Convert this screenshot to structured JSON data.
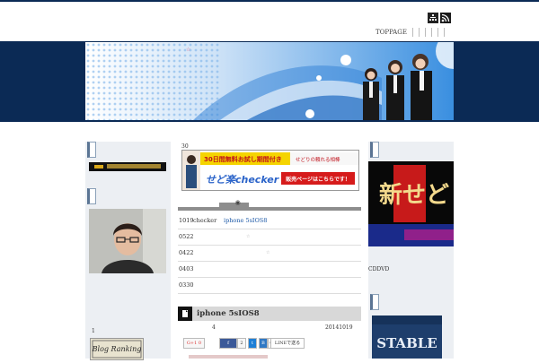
{
  "header": {
    "icons": [
      "sitemap-icon",
      "rss-icon"
    ],
    "nav": {
      "toppage": "TOPPAGE"
    },
    "banner_mark": "☆"
  },
  "left_sidebar": {
    "note": "1",
    "ranking_logo_text": "Blog Ranking"
  },
  "main": {
    "ad_count": "30",
    "ad_top_text": "30日間無料お試し期間付き",
    "ad_top_right": "せどりの頼れる相棒",
    "ad_logo": "せど楽checker",
    "ad_button": "販売ページはこちらです！",
    "list": [
      {
        "date": "1019",
        "extra": "checker",
        "title": "iphone 5sIOS8",
        "link": true
      },
      {
        "date": "0522",
        "extra": "",
        "title": "",
        "star": "☆",
        "link": false
      },
      {
        "date": "0422",
        "extra": "",
        "title": "",
        "star": "☆",
        "link": false
      },
      {
        "date": "0403",
        "extra": "",
        "title": "",
        "link": false
      },
      {
        "date": "0330",
        "extra": "",
        "title": "",
        "link": false
      }
    ],
    "post": {
      "title": "iphone 5sIOS8",
      "count": "4",
      "date": "20141019"
    },
    "share": {
      "gplus": "G+1  0",
      "like_count": "2",
      "b_label": "B",
      "b_count": "0",
      "line": "LINEで送る"
    }
  },
  "right_sidebar": {
    "cd_label": "CDDVD",
    "banner_text": "新せどりの",
    "stable_text": "STABLE"
  },
  "colors": {
    "navy": "#0b2a55",
    "sidebar_bg": "#eceff3",
    "link": "#1a57a6"
  }
}
